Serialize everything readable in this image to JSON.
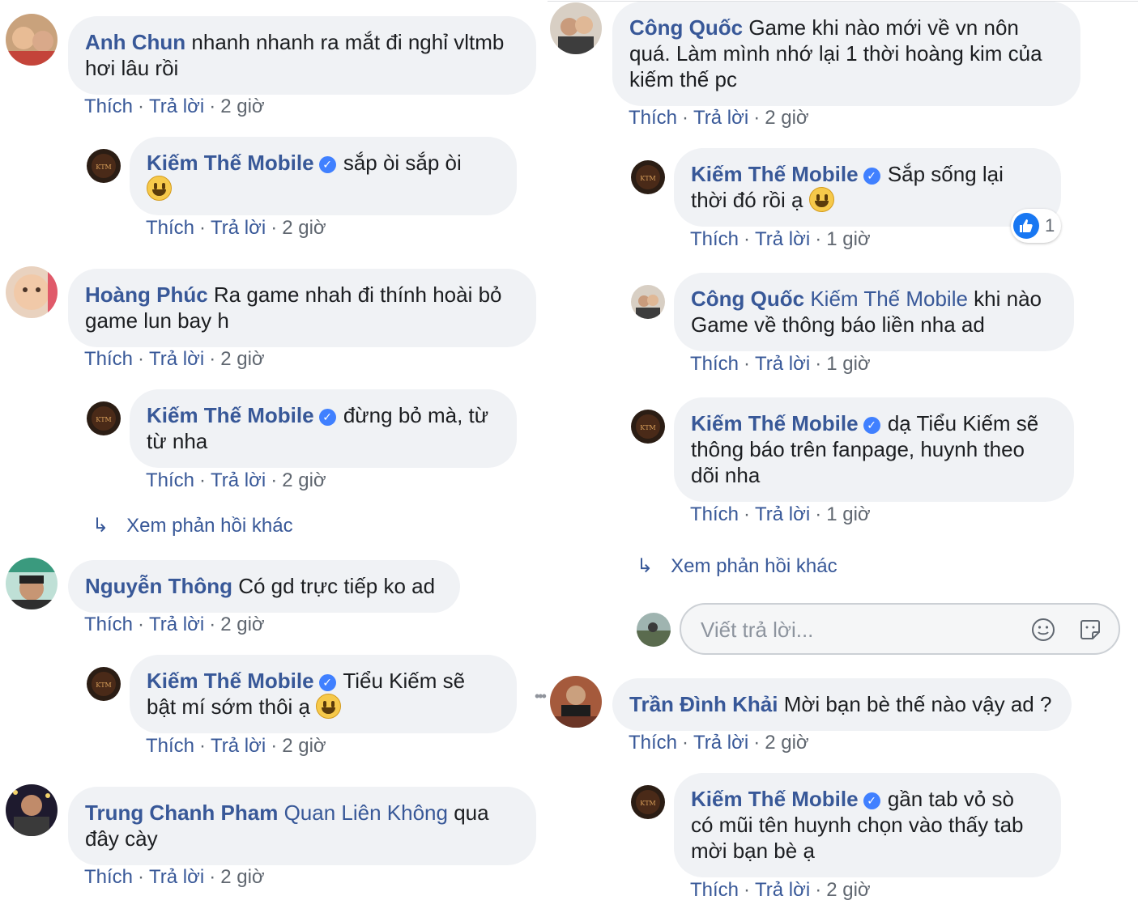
{
  "actions": {
    "like": "Thích",
    "reply": "Trả lời",
    "sep": "·"
  },
  "more_replies": "Xem phản hồi khác",
  "reply_box": {
    "placeholder": "Viết trả lời..."
  },
  "left": [
    {
      "name": "Anh Chun",
      "text": "nhanh nhanh ra mắt đi nghỉ vltmb hơi lâu rồi",
      "time": "2 giờ"
    },
    {
      "name": "Kiếm Thế Mobile",
      "text": "sắp òi sắp òi",
      "time": "2 giờ"
    },
    {
      "name": "Hoàng Phúc",
      "text": "Ra game nhah đi thính hoài bỏ game lun bay h",
      "time": "2 giờ"
    },
    {
      "name": "Kiếm Thế Mobile",
      "text": "đừng bỏ mà, từ từ nha",
      "time": "2 giờ"
    },
    {
      "name": "Nguyễn Thông",
      "text": "Có gd trực tiếp ko ad",
      "time": "2 giờ"
    },
    {
      "name": "Kiếm Thế Mobile",
      "text": "Tiểu Kiếm sẽ bật mí sớm thôi ạ",
      "time": "2 giờ"
    },
    {
      "name": "Trung Chanh Pham",
      "tag": "Quan Liên Không",
      "text": "qua đây cày",
      "time": "2 giờ"
    }
  ],
  "right": [
    {
      "name": "Công Quốc",
      "text": "Game khi nào mới về vn nôn quá. Làm mình nhớ lại 1 thời hoàng kim của kiếm thế pc",
      "time": "2 giờ"
    },
    {
      "name": "Kiếm Thế Mobile",
      "text": "Sắp sống lại thời đó rồi ạ",
      "time": "1 giờ",
      "likes": "1"
    },
    {
      "name": "Công Quốc",
      "tag": "Kiếm Thế Mobile",
      "text": "khi nào Game về thông báo liền nha ad",
      "time": "1 giờ"
    },
    {
      "name": "Kiếm Thế Mobile",
      "text": "dạ Tiểu Kiếm sẽ thông báo trên fanpage, huynh theo dõi nha",
      "time": "1 giờ"
    },
    {
      "name": "Trần Đình Khải",
      "text": "Mời bạn bè thế nào vậy ad ?",
      "time": "2 giờ"
    },
    {
      "name": "Kiếm Thế Mobile",
      "text": "gần tab vỏ sò có mũi tên huynh chọn vào thấy tab mời bạn bè ạ",
      "time": "2 giờ"
    }
  ],
  "colors": {
    "link": "#385898",
    "bubble": "#f0f2f5",
    "meta": "#606770",
    "verified": "#4080ff"
  }
}
